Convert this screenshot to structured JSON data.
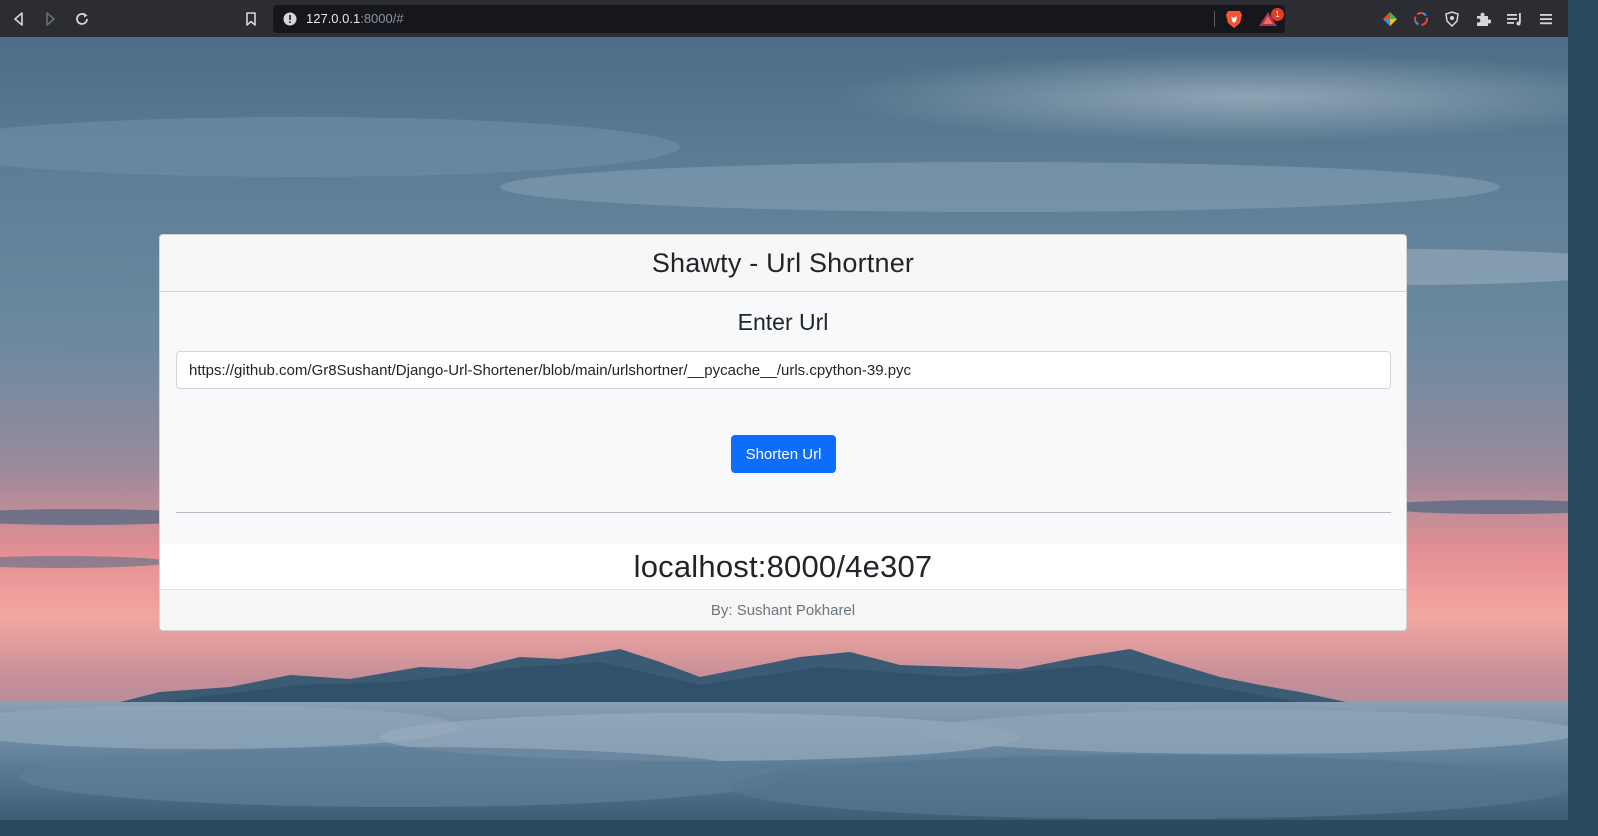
{
  "browser": {
    "address": {
      "host": "127.0.0.1",
      "path": ":8000/#"
    },
    "icons": {
      "back": "back-arrow-icon",
      "forward": "forward-arrow-icon",
      "reload": "reload-icon",
      "bookmark": "bookmark-icon",
      "site_info": "info-icon",
      "brave_shields": "brave-lion-icon",
      "brave_rewards": "rewards-triangle-icon",
      "extensions": [
        "color-picker-icon",
        "spinner-icon",
        "shield-icon",
        "puzzle-icon",
        "playlist-icon",
        "menu-icon"
      ]
    },
    "rewards_badge": "1"
  },
  "card": {
    "title": "Shawty - Url Shortner",
    "section_heading": "Enter Url",
    "input_value": "https://github.com/Gr8Sushant/Django-Url-Shortener/blob/main/urlshortner/__pycache__/urls.cpython-39.pyc",
    "button_label": "Shorten Url",
    "result": "localhost:8000/4e307",
    "footer": "By: Sushant Pokharel"
  },
  "colors": {
    "primary_button": "#0d6efd",
    "browser_bar": "#2b2d33",
    "address_field": "#15171c",
    "sky_top": "#4f7188",
    "sky_sunset": "#e99595"
  }
}
